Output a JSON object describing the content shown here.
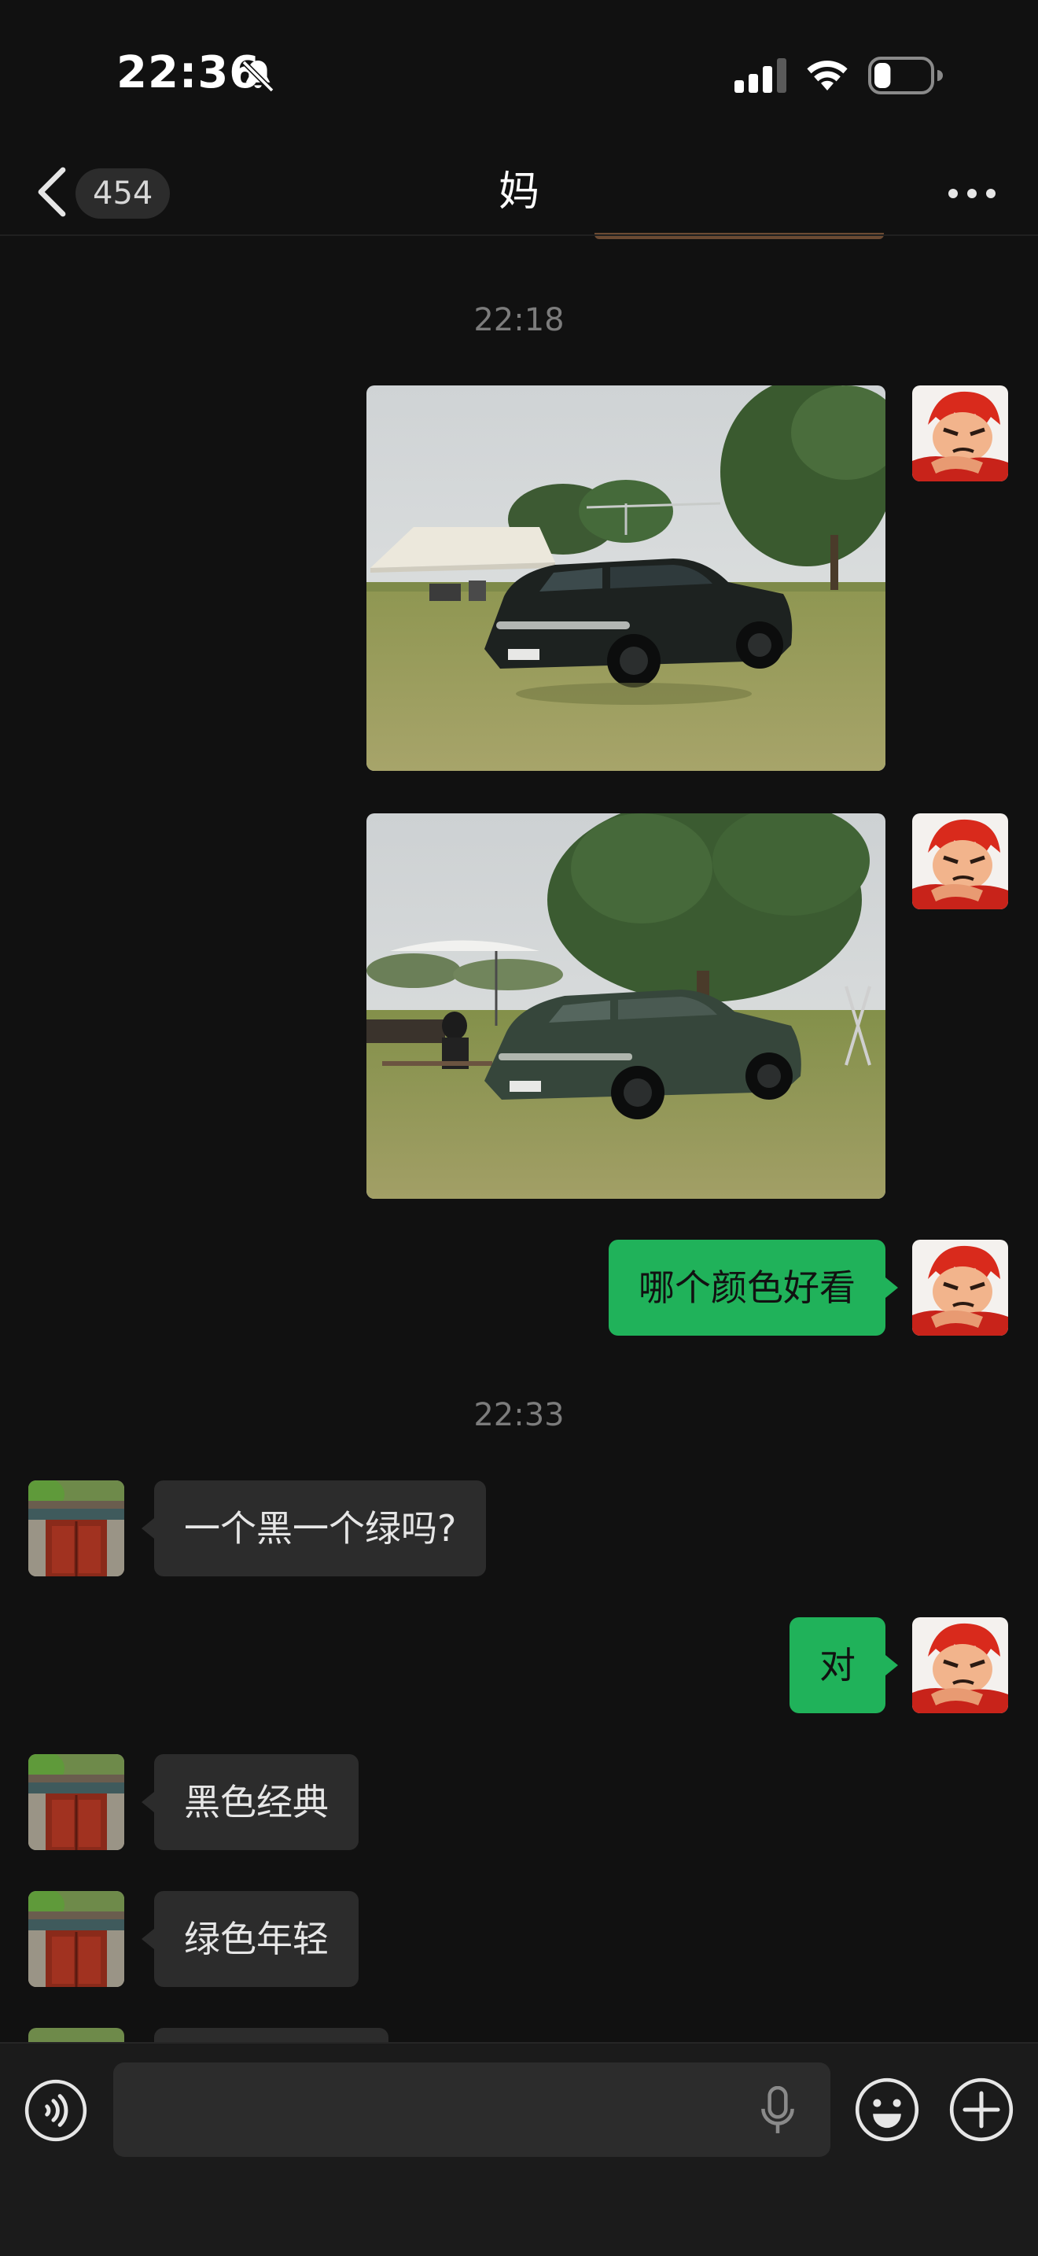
{
  "status_bar": {
    "time": "22:36",
    "battery_level": 0.3
  },
  "nav": {
    "unread_count": "454",
    "title": "妈"
  },
  "messages": [
    {
      "type": "timestamp",
      "text": "22:18"
    },
    {
      "type": "image",
      "sender": "me",
      "subject": "black SUV on grass"
    },
    {
      "type": "image",
      "sender": "me",
      "subject": "green SUV under tree"
    },
    {
      "type": "text",
      "sender": "me",
      "text": "哪个颜色好看"
    },
    {
      "type": "timestamp",
      "text": "22:33"
    },
    {
      "type": "text",
      "sender": "mom",
      "text": "一个黑一个绿吗?"
    },
    {
      "type": "text",
      "sender": "me",
      "text": "对"
    },
    {
      "type": "text",
      "sender": "mom",
      "text": "黑色经典"
    },
    {
      "type": "text",
      "sender": "mom",
      "text": "绿色年轻"
    }
  ],
  "input": {
    "value": "",
    "placeholder": ""
  },
  "colors": {
    "background": "#111111",
    "my_bubble": "#20b25a",
    "their_bubble": "#2c2c2c",
    "input_bar": "#1b1b1b"
  },
  "icons": [
    "bell-muted-icon",
    "signal-icon",
    "wifi-icon",
    "battery-icon",
    "back-icon",
    "more-icon",
    "voice-icon",
    "microphone-icon",
    "emoji-icon",
    "plus-icon"
  ]
}
